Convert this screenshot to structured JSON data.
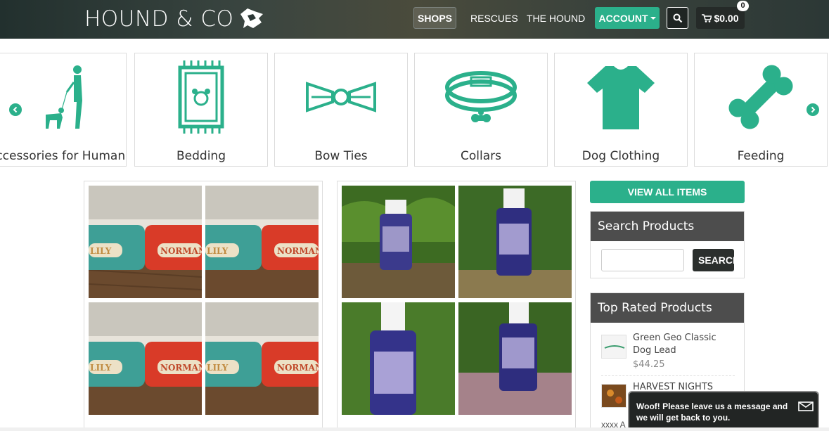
{
  "header": {
    "logo_text": "HOUND & CO",
    "nav": {
      "shops": "SHOPS",
      "rescues": "RESCUES",
      "the_hound": "THE HOUND",
      "account": "ACCOUNT",
      "cart_total": "$0.00",
      "cart_count": "0"
    },
    "icons": {
      "search": "search-icon",
      "cart": "cart-icon",
      "logo": "dog-head-icon"
    }
  },
  "categories": [
    {
      "label": "Accessories for Humans",
      "icon": "person-walking-dog-icon"
    },
    {
      "label": "Bedding",
      "icon": "bed-mat-icon"
    },
    {
      "label": "Bow Ties",
      "icon": "bow-tie-icon"
    },
    {
      "label": "Collars",
      "icon": "collar-icon"
    },
    {
      "label": "Dog Clothing",
      "icon": "t-shirt-icon"
    },
    {
      "label": "Feeding",
      "icon": "bone-icon"
    }
  ],
  "carousel": {
    "prev_icon": "chevron-left-icon",
    "next_icon": "chevron-right-icon"
  },
  "products": {
    "bowls_photo_text": [
      "LILY",
      "NORMAN"
    ]
  },
  "sidebar": {
    "view_all": "VIEW ALL ITEMS",
    "search_title": "Search Products",
    "search_button": "SEARCH",
    "search_placeholder": "",
    "top_rated_title": "Top Rated Products",
    "top_rated": [
      {
        "name": "Green Geo Classic Dog Lead",
        "price": "$44.25"
      },
      {
        "name": "HARVEST NIGHTS male",
        "price": ""
      }
    ],
    "clipped_text": "xxxx A"
  },
  "chat": {
    "message": "Woof! Please leave us a message and we will get back to you.",
    "icon": "envelope-icon"
  },
  "colors": {
    "accent": "#2bb08b",
    "panel_head": "#4d4d4d",
    "header_dark": "#2c3836"
  }
}
